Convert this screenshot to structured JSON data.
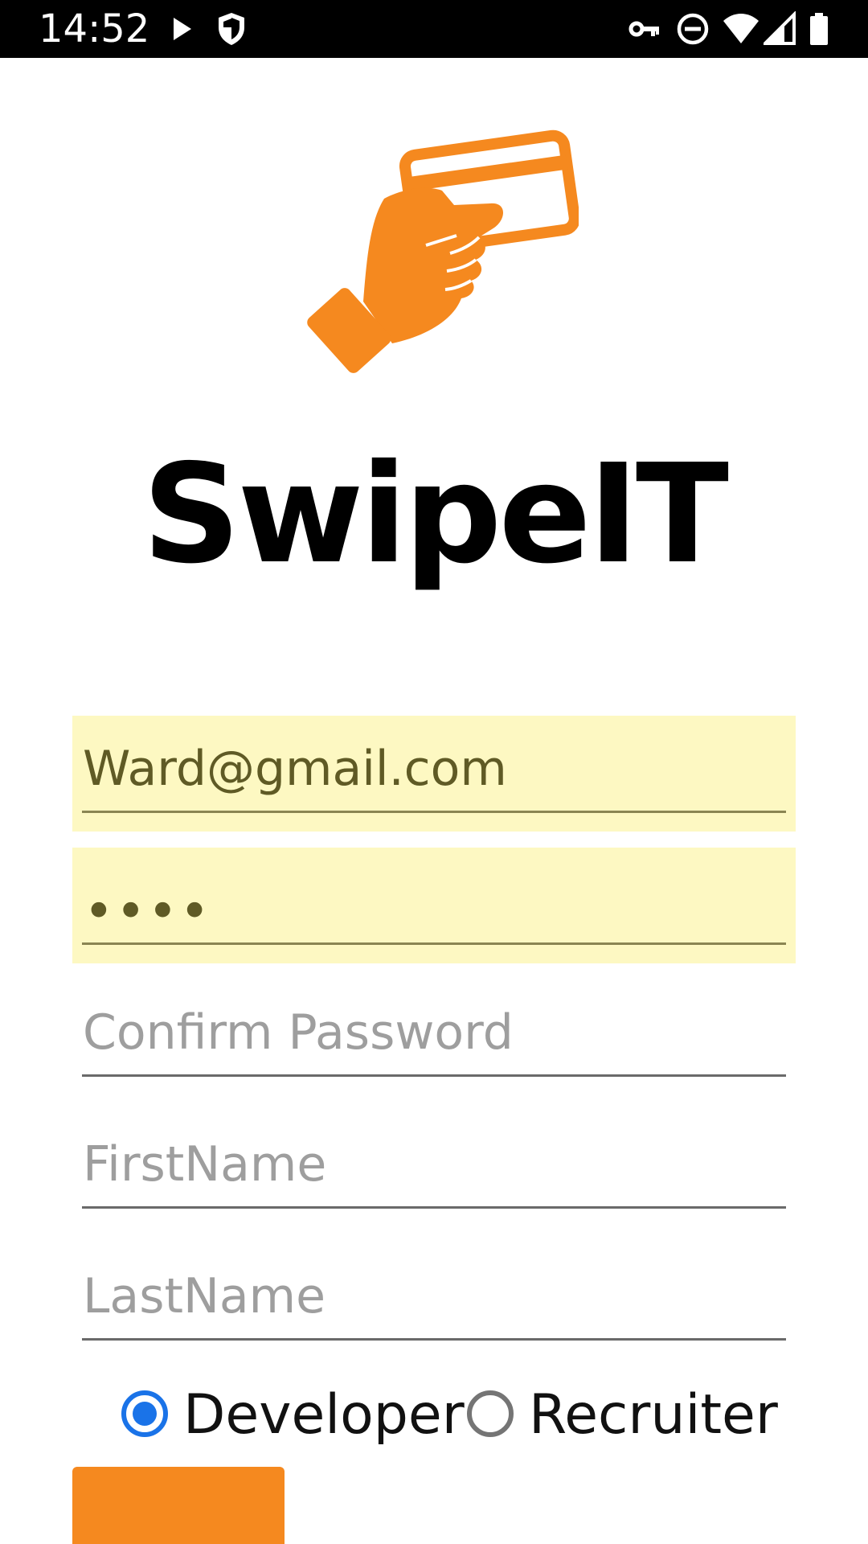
{
  "status_bar": {
    "time": "14:52",
    "left_icons": [
      "play-icon",
      "shield-icon"
    ],
    "right_icons": [
      "vpn-key-icon",
      "do-not-disturb-icon",
      "wifi-icon",
      "cell-signal-icon",
      "battery-icon"
    ]
  },
  "app": {
    "title": "SwipeIT",
    "logo_icon": "hand-holding-card-icon",
    "accent_color": "#f5891f"
  },
  "form": {
    "email_value": "Ward@gmail.com",
    "password_mask": "••••",
    "confirm_password_placeholder": "Confirm Password",
    "firstname_placeholder": "FirstName",
    "lastname_placeholder": "LastName",
    "autofill_color": "#fdf8c2"
  },
  "role": {
    "options": [
      {
        "label": "Developer",
        "selected": true
      },
      {
        "label": "Recruiter",
        "selected": false
      }
    ],
    "selected_color": "#1a73e8"
  }
}
